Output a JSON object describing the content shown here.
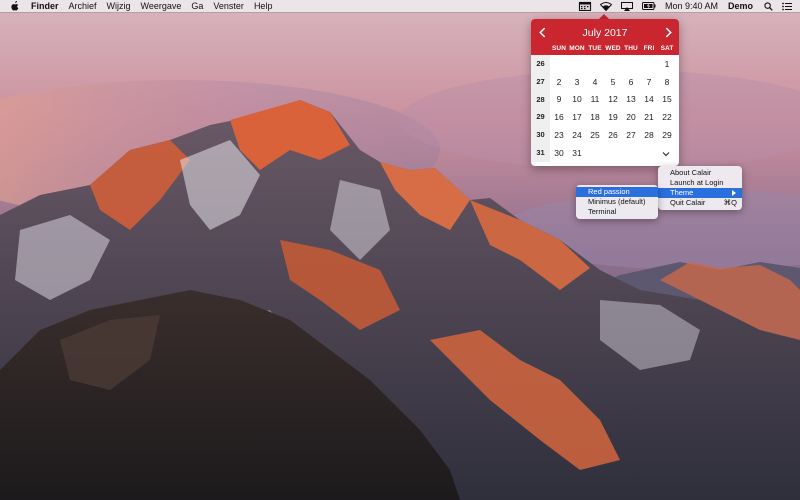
{
  "menubar": {
    "apple_icon": "apple-logo-icon",
    "app_name": "Finder",
    "menus": [
      "Archief",
      "Wijzig",
      "Weergave",
      "Ga",
      "Venster",
      "Help"
    ],
    "status_icons": [
      "calendar-icon",
      "wifi-icon",
      "airplay-icon",
      "battery-icon"
    ],
    "clock": "Mon 9:40 AM",
    "user": "Demo",
    "right_icons": [
      "spotlight-search-icon",
      "notification-center-icon"
    ]
  },
  "calendar": {
    "month_title": "July 2017",
    "prev_icon": "chevron-left-icon",
    "next_icon": "chevron-right-icon",
    "weekdays": [
      "SUN",
      "MON",
      "TUE",
      "WED",
      "THU",
      "FRI",
      "SAT"
    ],
    "weeks": [
      {
        "week": "26",
        "days": [
          "",
          "",
          "",
          "",
          "",
          "",
          "1"
        ]
      },
      {
        "week": "27",
        "days": [
          "2",
          "3",
          "4",
          "5",
          "6",
          "7",
          "8"
        ]
      },
      {
        "week": "28",
        "days": [
          "9",
          "10",
          "11",
          "12",
          "13",
          "14",
          "15"
        ]
      },
      {
        "week": "29",
        "days": [
          "16",
          "17",
          "18",
          "19",
          "20",
          "21",
          "22"
        ]
      },
      {
        "week": "30",
        "days": [
          "23",
          "24",
          "25",
          "26",
          "27",
          "28",
          "29"
        ]
      },
      {
        "week": "31",
        "days": [
          "30",
          "31",
          "",
          "",
          "",
          "",
          ""
        ]
      }
    ],
    "expand_icon": "chevron-down-icon",
    "accent_color": "#c9262f"
  },
  "app_menu": {
    "items": [
      {
        "label": "About Calair",
        "shortcut": ""
      },
      {
        "label": "Launch at Login",
        "shortcut": ""
      },
      {
        "label": "Theme",
        "shortcut": "",
        "has_submenu": true,
        "selected": true
      },
      {
        "label": "Quit Calair",
        "shortcut": "⌘Q"
      }
    ]
  },
  "theme_menu": {
    "items": [
      {
        "label": "Red passion",
        "selected": true
      },
      {
        "label": "Minimus (default)",
        "selected": false
      },
      {
        "label": "Terminal",
        "selected": false
      }
    ]
  },
  "colors": {
    "menu_highlight": "#2a6fde",
    "menubar_bg": "#ece8ec"
  }
}
